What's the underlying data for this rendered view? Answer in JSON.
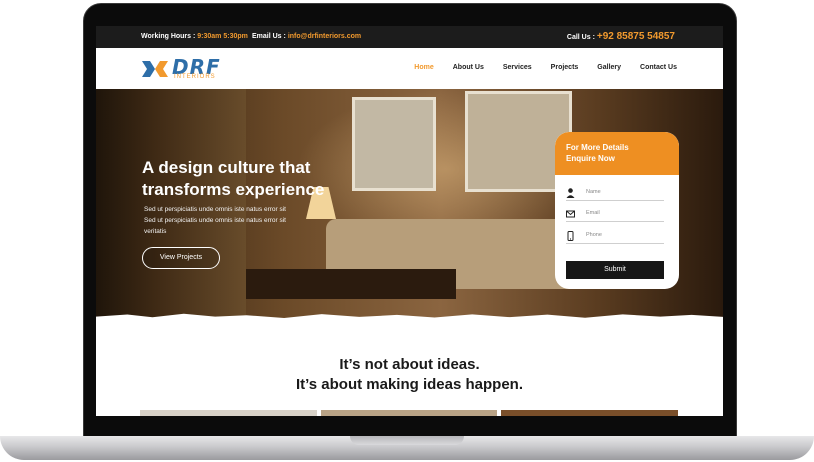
{
  "topbar": {
    "hours_label": "Working Hours :",
    "hours_value": "9:30am 5:30pm",
    "email_label": "Email Us :",
    "email_value": "info@drfinteriors.com",
    "call_label": "Call Us :",
    "call_value": "+92 85875 54857"
  },
  "brand": {
    "name": "DRF",
    "sub": "INTERIORS"
  },
  "nav": {
    "items": [
      "Home",
      "About Us",
      "Services",
      "Projects",
      "Gallery",
      "Contact Us"
    ],
    "active": "Home"
  },
  "hero": {
    "title_line1": "A design culture that",
    "title_line2": "transforms experience",
    "text_line1": "Sed ut perspiciatis unde omnis iste natus error sit",
    "text_line2": "Sed ut perspiciatis unde omnis iste natus error sit",
    "text_line3": "veritatis",
    "button": "View Projects"
  },
  "enquiry": {
    "title_line1": "For More Details",
    "title_line2": "Enquire Now",
    "name_placeholder": "Name",
    "email_placeholder": "Email",
    "phone_placeholder": "Phone",
    "submit": "Submit"
  },
  "tagline": {
    "line1": "It’s not about ideas.",
    "line2": "It’s about making ideas happen."
  },
  "colors": {
    "accent": "#ee8f22",
    "dark": "#1c1c1c",
    "brand_blue": "#2e6ea8"
  }
}
